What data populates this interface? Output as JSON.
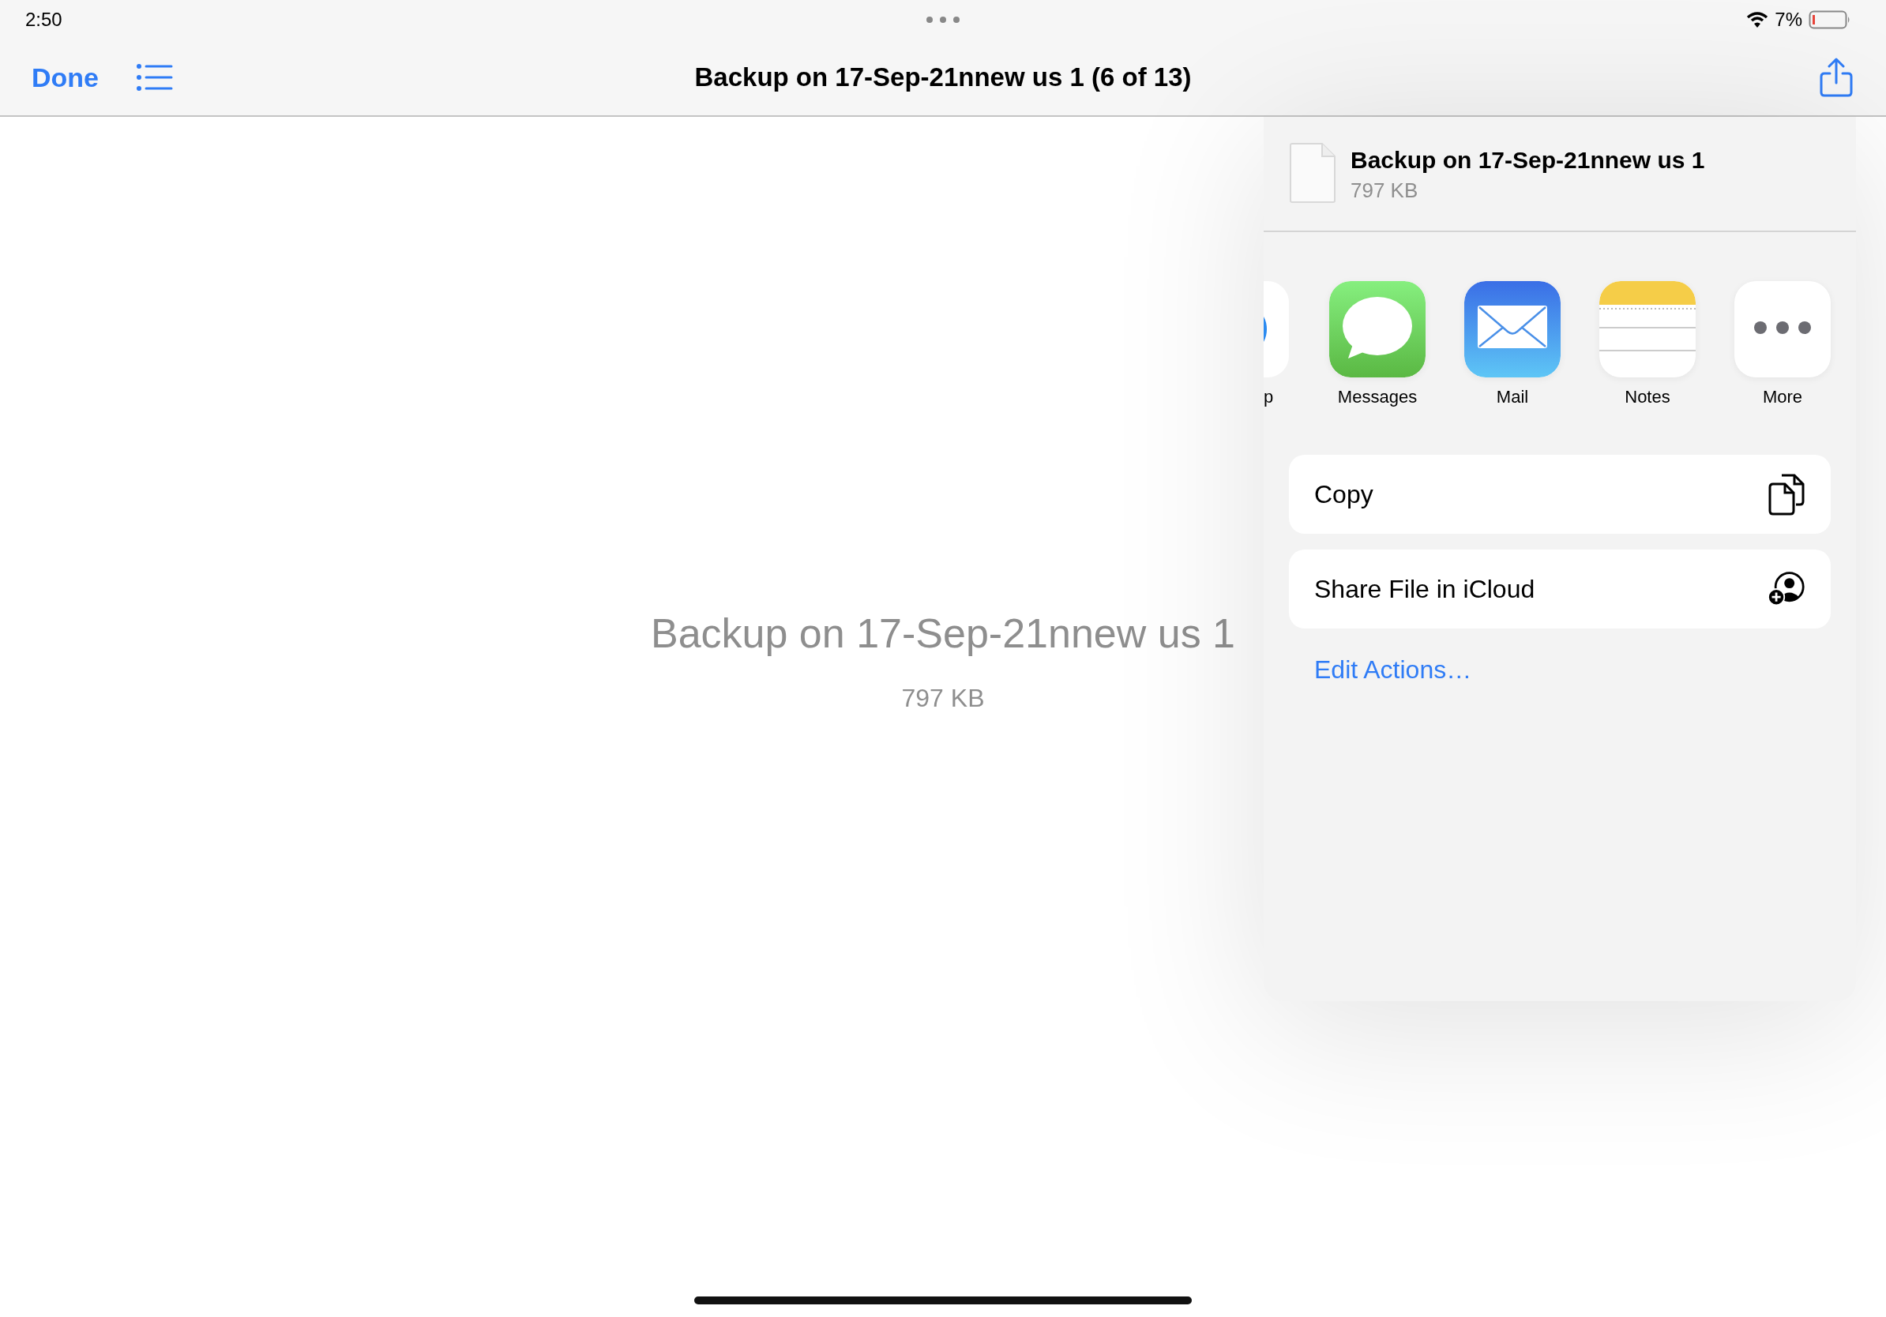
{
  "status_bar": {
    "time": "2:50",
    "battery": "7%"
  },
  "nav": {
    "done": "Done",
    "title": "Backup on 17-Sep-21nnew us 1 (6 of 13)"
  },
  "document": {
    "name": "Backup on 17-Sep-21nnew us 1",
    "size": "797 KB"
  },
  "share_sheet": {
    "file": {
      "name": "Backup on 17-Sep-21nnew us 1",
      "size": "797 KB"
    },
    "apps": [
      {
        "kind": "partial",
        "label": "p"
      },
      {
        "kind": "messages",
        "label": "Messages"
      },
      {
        "kind": "mail",
        "label": "Mail"
      },
      {
        "kind": "notes",
        "label": "Notes"
      },
      {
        "kind": "more",
        "label": "More"
      }
    ],
    "actions": [
      {
        "kind": "copy",
        "label": "Copy"
      },
      {
        "kind": "share-icloud",
        "label": "Share File in iCloud"
      }
    ],
    "edit_actions": "Edit Actions…"
  }
}
